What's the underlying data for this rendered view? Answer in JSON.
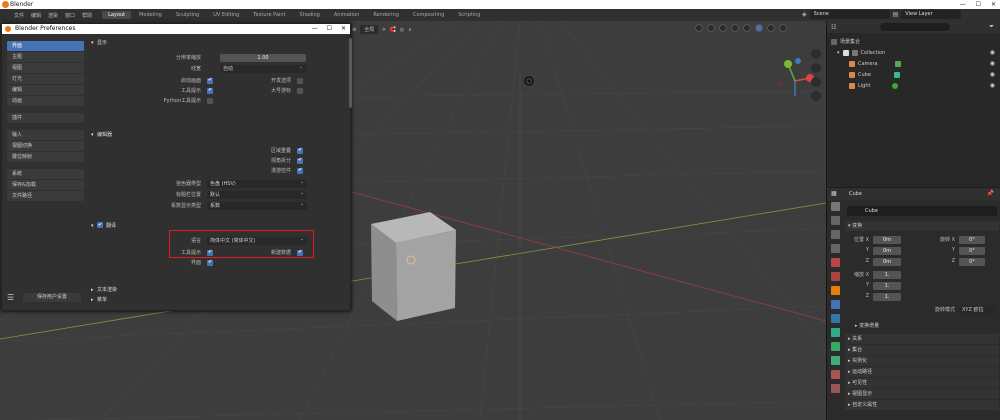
{
  "app": {
    "window_title": "Blender"
  },
  "topbar": {
    "menus": [
      "文件",
      "编辑",
      "渲染",
      "窗口",
      "帮助"
    ],
    "workspaces": [
      "Layout",
      "Modeling",
      "Sculpting",
      "UV Editing",
      "Texture Paint",
      "Shading",
      "Animation",
      "Rendering",
      "Compositing",
      "Scripting"
    ],
    "active_workspace": "Layout",
    "scene": "Scene",
    "view_layer": "View Layer"
  },
  "viewport": {
    "transform_orientation": "全局"
  },
  "prefs": {
    "title": "Blender Preferences",
    "sidebar": [
      {
        "label": "界面",
        "active": true
      },
      {
        "label": "主题"
      },
      {
        "label": "视图"
      },
      {
        "label": "灯光"
      },
      {
        "label": "编辑"
      },
      {
        "label": "动画"
      },
      {
        "label": "插件",
        "gap": true
      },
      {
        "label": "输入",
        "gap": true
      },
      {
        "label": "视图切换"
      },
      {
        "label": "键位映射"
      },
      {
        "label": "系统",
        "gap": true
      },
      {
        "label": "保存&加载"
      },
      {
        "label": "文件路径"
      }
    ],
    "save_button": "保存用户设置",
    "display": {
      "header": "显示",
      "resolution_scale_label": "分辨率缩放",
      "resolution_scale_value": "1.00",
      "line_width_label": "线宽",
      "line_width_value": "自动",
      "splash_label": "启动画面",
      "tooltips_label": "工具提示",
      "python_tooltips_label": "Python工具提示",
      "dev_extras_label": "开发选项",
      "large_cursor_label": "大号游标"
    },
    "editors": {
      "header": "编辑器",
      "region_overlap_label": "区域重叠",
      "corner_split_label": "拐角拆分",
      "nav_controls_label": "漫游控件",
      "color_picker_label": "拾色器类型",
      "color_picker_value": "色盘 (HSV)",
      "header_pos_label": "标题栏位置",
      "header_pos_value": "默认",
      "factor_display_label": "系数显示类型",
      "factor_display_value": "系数"
    },
    "translation": {
      "header": "翻译",
      "language_label": "语言",
      "language_value": "简体中文 (简体中文)",
      "tooltips_label": "工具提示",
      "interface_label": "界面",
      "new_data_label": "新建数据"
    },
    "text_render_header": "文本渲染",
    "menus_header": "菜单"
  },
  "outliner": {
    "root": "场景集合",
    "collection": "Collection",
    "items": [
      "Camera",
      "Cube",
      "Light"
    ]
  },
  "properties": {
    "object_name_header": "Cube",
    "object_name": "Cube",
    "transform_header": "变换",
    "location_label": "位置 X",
    "rotation_label": "旋转 X",
    "scale_label": "缩放 X",
    "axis_y": "Y",
    "axis_z": "Z",
    "loc": [
      "0m",
      "0m",
      "0m"
    ],
    "rot": [
      "0°",
      "0°",
      "0°"
    ],
    "scale": [
      "1.",
      "1.",
      "1."
    ],
    "rotation_mode_label": "旋转模式",
    "rotation_mode_value": "XYZ 欧拉",
    "delta_header": "变换增量",
    "sections": [
      "关系",
      "集合",
      "实例化",
      "运动路径",
      "可见性",
      "视图显示",
      "自定义属性"
    ]
  },
  "colors": {
    "accent": "#4772b3",
    "highlight_red": "#e02020",
    "blender_orange": "#e87d0d"
  }
}
